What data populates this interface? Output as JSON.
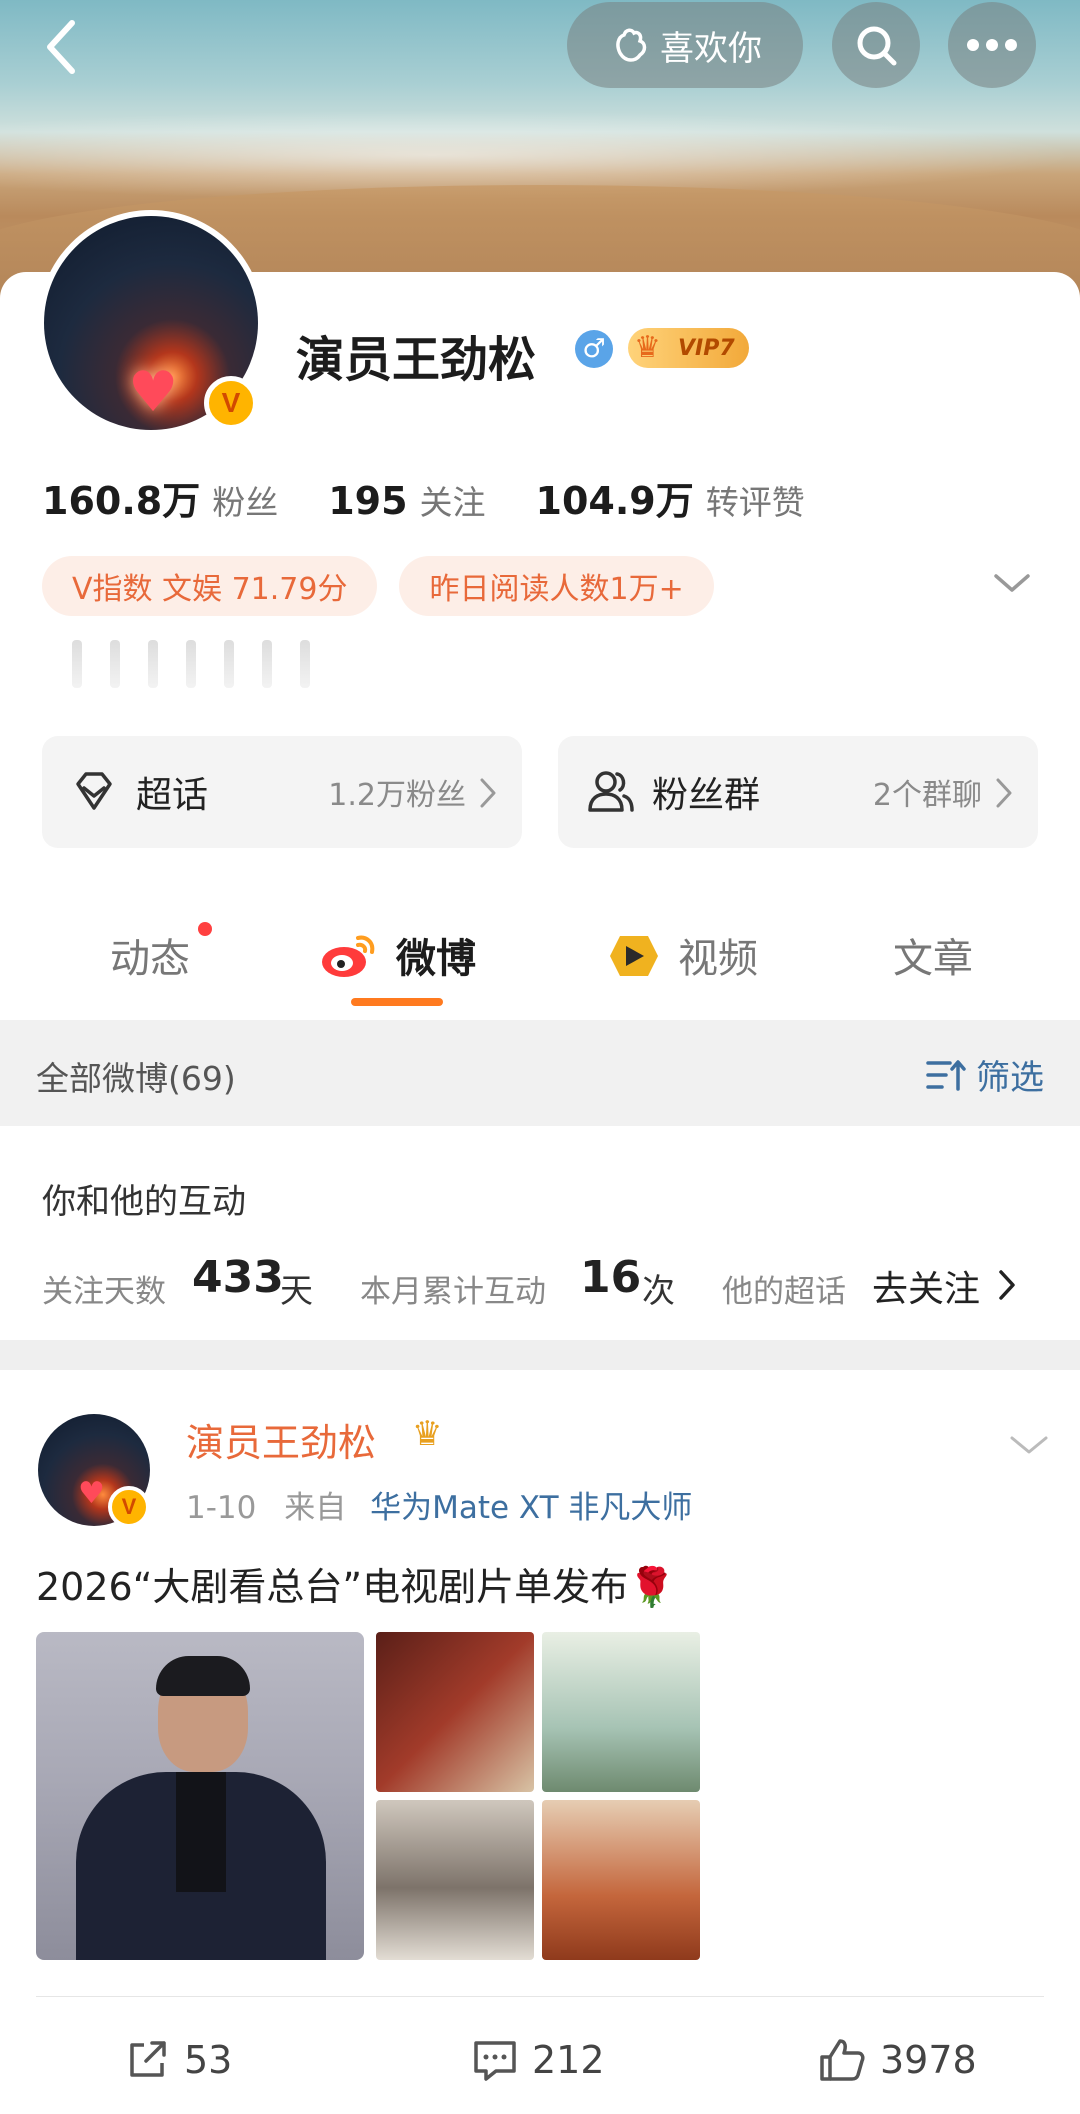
{
  "header": {
    "like_label": "喜欢你"
  },
  "profile": {
    "name": "演员王劲松",
    "vip_level": "VIP7",
    "gender_symbol": "♂",
    "verified_badge": "V",
    "stats": [
      {
        "value": "160.8万",
        "label": "粉丝"
      },
      {
        "value": "195",
        "label": "关注"
      },
      {
        "value": "104.9万",
        "label": "转评赞"
      }
    ],
    "tags": [
      "V指数 文娱 71.79分",
      "昨日阅读人数1万+"
    ]
  },
  "cards": {
    "super_topic": {
      "title": "超话",
      "sub": "1.2万粉丝"
    },
    "fan_group": {
      "title": "粉丝群",
      "sub": "2个群聊"
    }
  },
  "tabs": [
    "动态",
    "微博",
    "视频",
    "文章"
  ],
  "filter": {
    "label": "全部微博(69)",
    "action": "筛选"
  },
  "interaction": {
    "title": "你和他的互动",
    "follow_days_label": "关注天数",
    "follow_days_value": "433",
    "follow_days_unit": "天",
    "monthly_label": "本月累计互动",
    "monthly_value": "16",
    "monthly_unit": "次",
    "supertopic_label": "他的超话",
    "supertopic_action": "去关注"
  },
  "post": {
    "author": "演员王劲松",
    "date": "1-10",
    "from_label": "来自",
    "source": "华为Mate XT 非凡大师",
    "text": "2026“大剧看总台”电视剧片单发布",
    "emoji": "🌹",
    "reposts": "53",
    "comments": "212",
    "likes": "3978"
  },
  "colors": {
    "accent_orange": "#ff7a1f",
    "link_blue": "#3d6fa0",
    "tag_bg": "#fdeee7",
    "tag_text": "#e8693a"
  }
}
